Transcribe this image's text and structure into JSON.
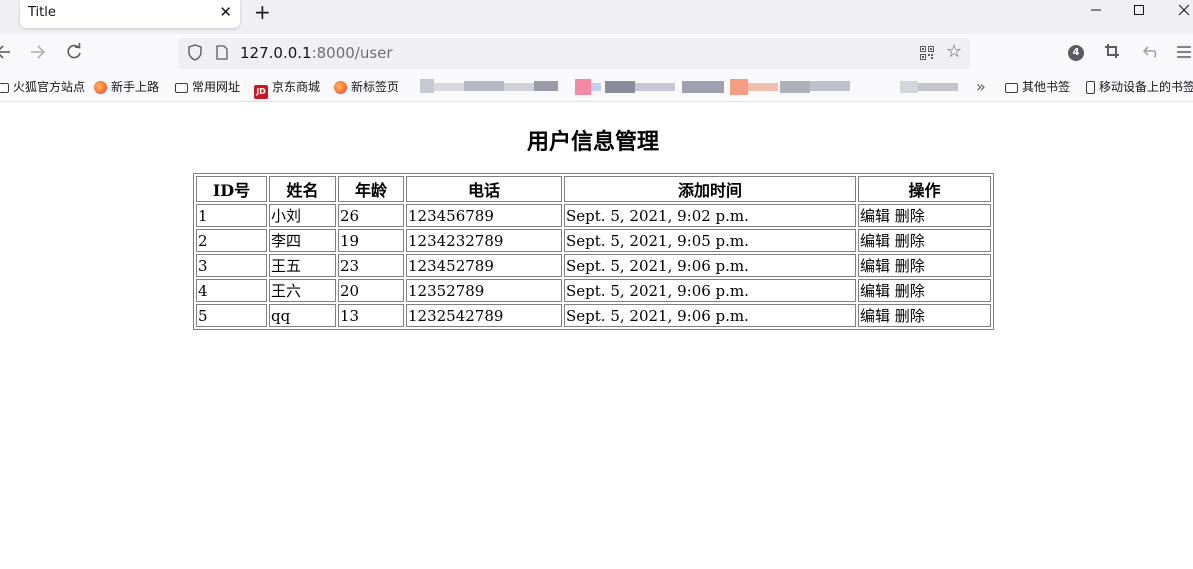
{
  "browser": {
    "tab_title": "Title",
    "tab_close": "✕",
    "new_tab": "+",
    "url_host": "127.0.0.1",
    "url_path": ":8000/user",
    "extension_badge": "4",
    "bookmarks": [
      {
        "label": "火狐官方站点",
        "icon": "folder-icon"
      },
      {
        "label": "新手上路",
        "icon": "firefox-icon"
      },
      {
        "label": "常用网址",
        "icon": "folder-icon"
      },
      {
        "label": "京东商城",
        "icon": "jd-icon"
      },
      {
        "label": "新标签页",
        "icon": "firefox-icon"
      }
    ],
    "other_bookmarks": "其他书签",
    "mobile_bookmarks": "移动设备上的书签",
    "jd_mark": "JD",
    "overflow_chevron": "»"
  },
  "page": {
    "title": "用户信息管理",
    "columns": [
      "ID号",
      "姓名",
      "年龄",
      "电话",
      "添加时间",
      "操作"
    ],
    "edit_label": "编辑",
    "delete_label": "删除",
    "rows": [
      {
        "id": "1",
        "name": "小刘",
        "age": "26",
        "phone": "123456789",
        "added": "Sept. 5, 2021, 9:02 p.m."
      },
      {
        "id": "2",
        "name": "李四",
        "age": "19",
        "phone": "1234232789",
        "added": "Sept. 5, 2021, 9:05 p.m."
      },
      {
        "id": "3",
        "name": "王五",
        "age": "23",
        "phone": "123452789",
        "added": "Sept. 5, 2021, 9:06 p.m."
      },
      {
        "id": "4",
        "name": "王六",
        "age": "20",
        "phone": "12352789",
        "added": "Sept. 5, 2021, 9:06 p.m."
      },
      {
        "id": "5",
        "name": "qq",
        "age": "13",
        "phone": "1232542789",
        "added": "Sept. 5, 2021, 9:06 p.m."
      }
    ]
  }
}
